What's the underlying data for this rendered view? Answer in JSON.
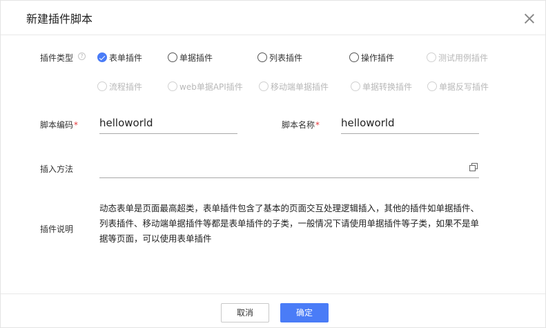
{
  "dialog": {
    "title": "新建插件脚本"
  },
  "plugin_type": {
    "label": "插件类型",
    "help": "?",
    "options": [
      {
        "label": "表单插件",
        "checked": true,
        "disabled": false
      },
      {
        "label": "单据插件",
        "checked": false,
        "disabled": false
      },
      {
        "label": "列表插件",
        "checked": false,
        "disabled": false
      },
      {
        "label": "操作插件",
        "checked": false,
        "disabled": false
      },
      {
        "label": "测试用例插件",
        "checked": false,
        "disabled": true
      },
      {
        "label": "流程插件",
        "checked": false,
        "disabled": true
      },
      {
        "label": "web单据API插件",
        "checked": false,
        "disabled": true
      },
      {
        "label": "移动端单据插件",
        "checked": false,
        "disabled": true
      },
      {
        "label": "单据转换插件",
        "checked": false,
        "disabled": true
      },
      {
        "label": "单据反写插件",
        "checked": false,
        "disabled": true
      }
    ]
  },
  "script_code": {
    "label": "脚本编码",
    "required_mark": "*",
    "value": "helloworld"
  },
  "script_name": {
    "label": "脚本名称",
    "required_mark": "*",
    "value": "helloworld"
  },
  "insert_method": {
    "label": "插入方法",
    "value": ""
  },
  "plugin_desc": {
    "label": "插件说明",
    "text": "动态表单是页面最高超类，表单插件包含了基本的页面交互处理逻辑插入，其他的插件如单据插件、列表插件、移动端单据插件等都是表单插件的子类，一般情况下请使用单据插件等子类，如果不是单据等页面，可以使用表单插件"
  },
  "footer": {
    "cancel_label": "取消",
    "ok_label": "确定"
  },
  "colors": {
    "accent": "#4a7cf7",
    "required": "#e4393c"
  }
}
